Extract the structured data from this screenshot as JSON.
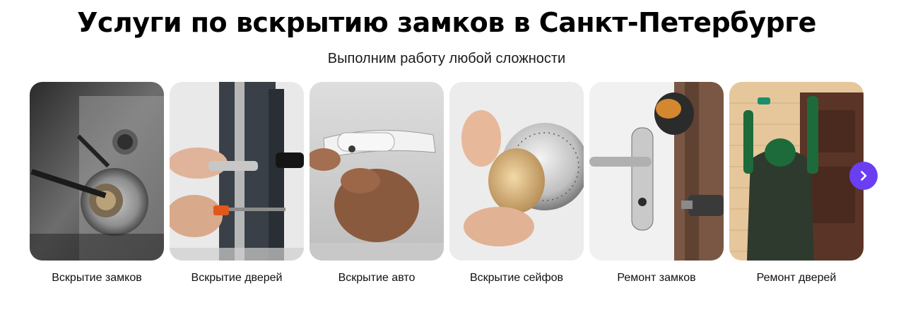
{
  "header": {
    "title": "Услуги по вскрытию замков в Санкт-Петербурге",
    "subtitle": "Выполним работу любой сложности"
  },
  "services": [
    {
      "label": "Вскрытие замков",
      "image": "lock-cylinder-picking-photo"
    },
    {
      "label": "Вскрытие дверей",
      "image": "door-lock-opening-photo"
    },
    {
      "label": "Вскрытие авто",
      "image": "car-door-handle-photo"
    },
    {
      "label": "Вскрытие сейфов",
      "image": "safe-combination-dial-photo"
    },
    {
      "label": "Ремонт замков",
      "image": "door-handle-repair-photo"
    },
    {
      "label": "Ремонт дверей",
      "image": "door-installation-worker-photo"
    }
  ],
  "carousel": {
    "next_icon": "chevron-right-icon",
    "accent_color": "#6a3ff2"
  }
}
